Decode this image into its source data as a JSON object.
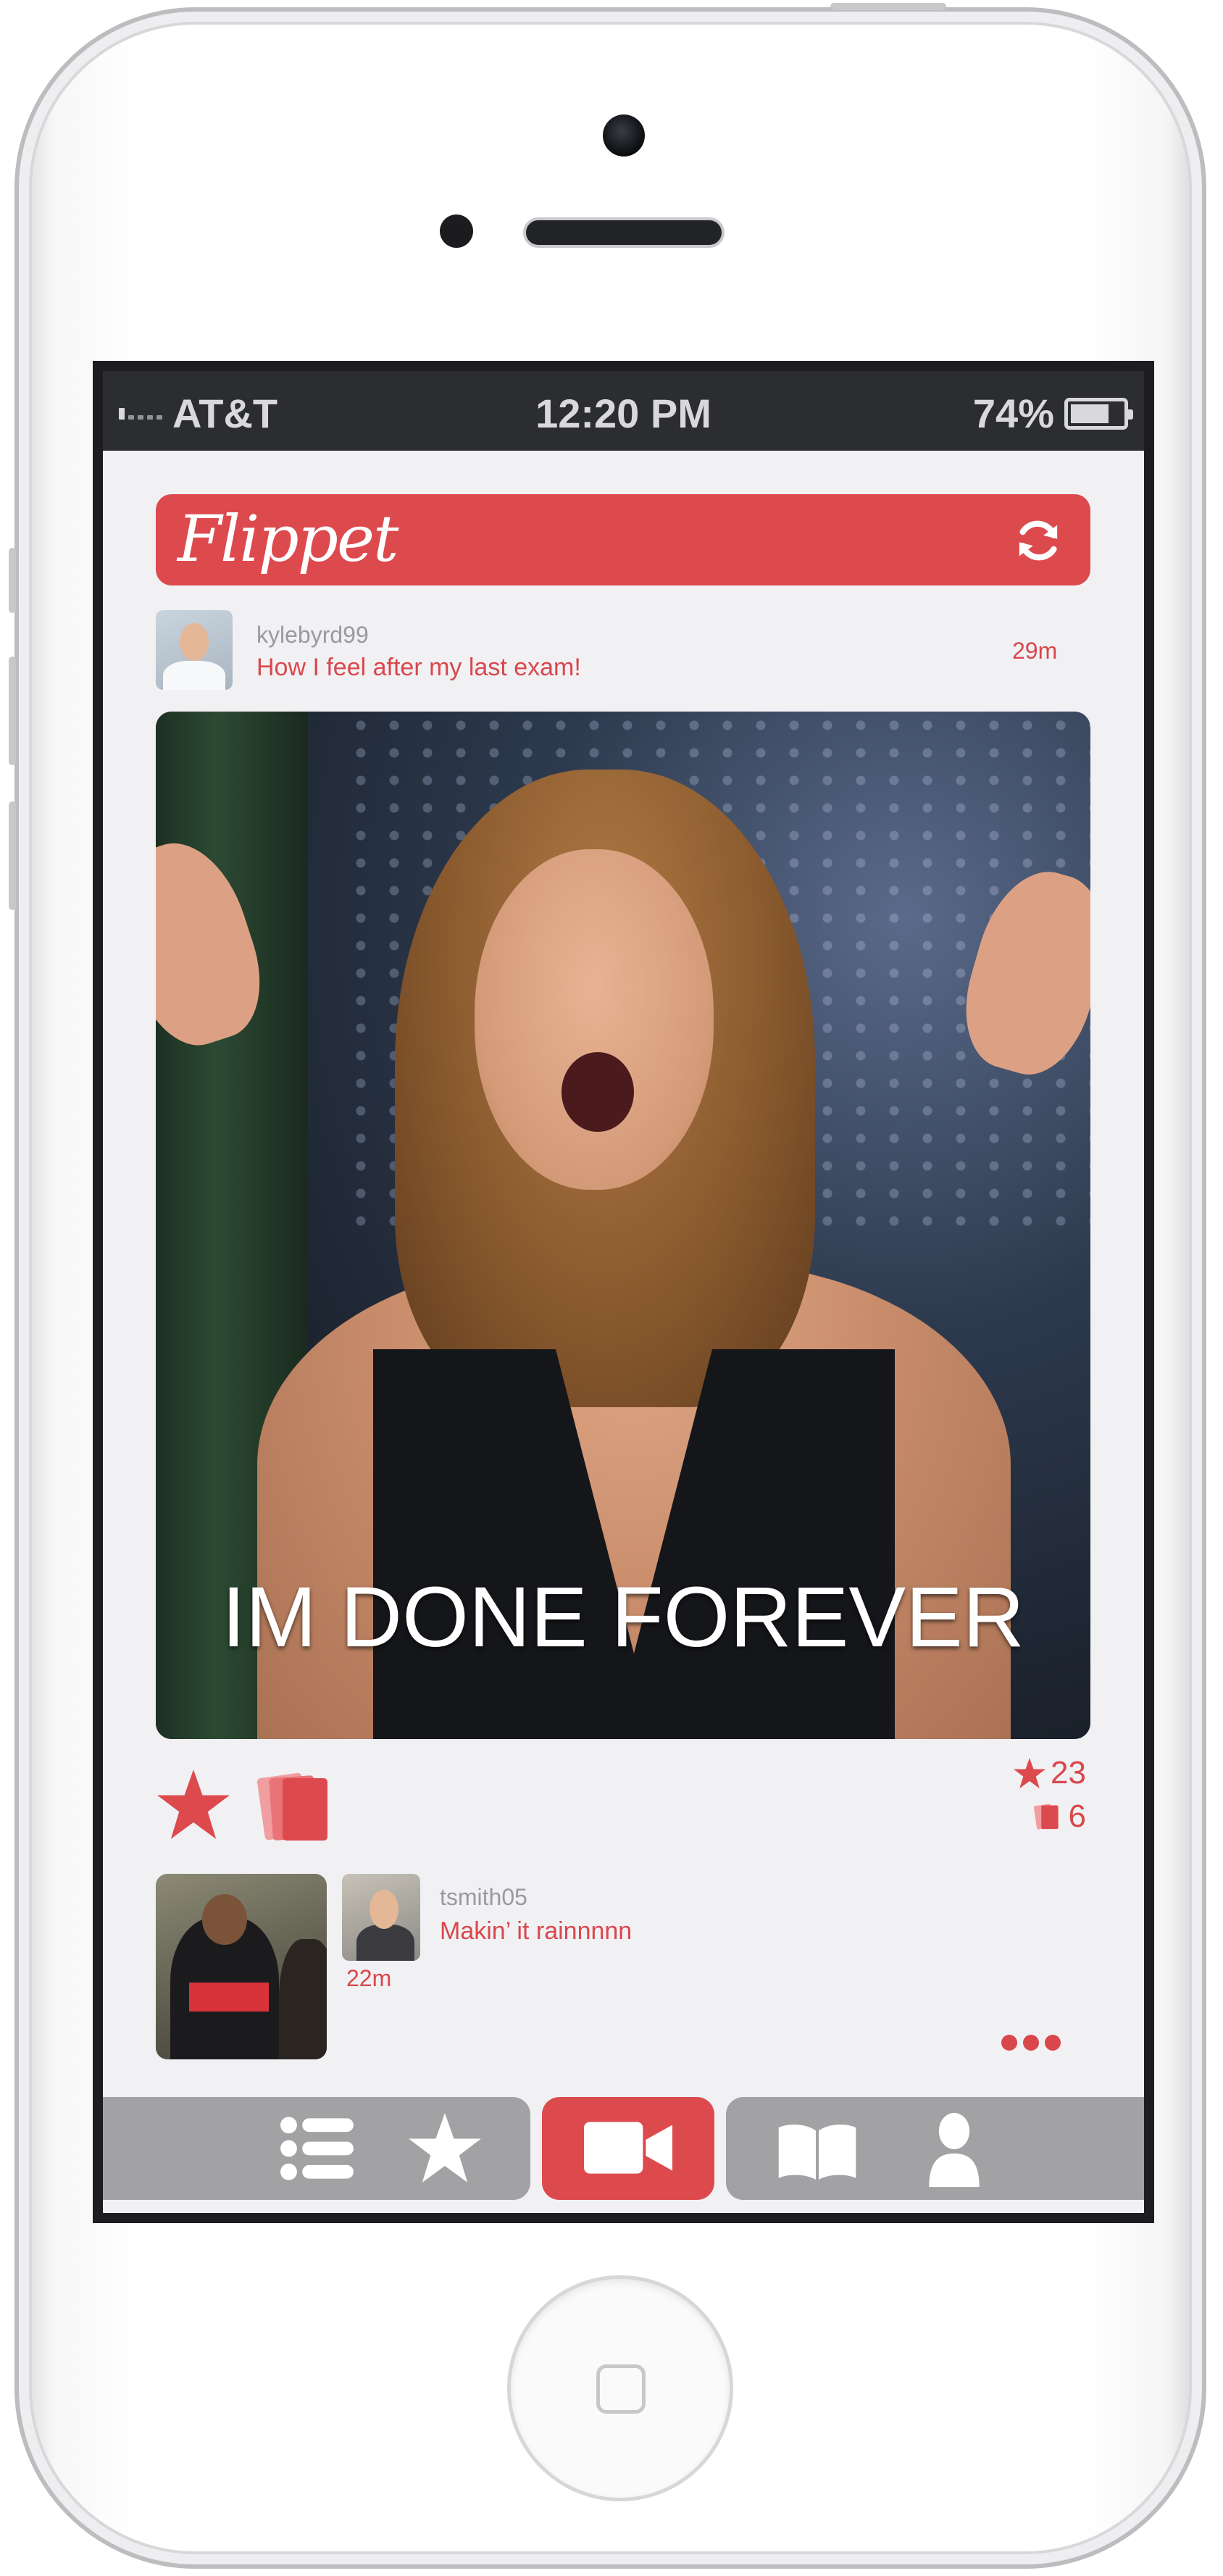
{
  "status_bar": {
    "carrier": "AT&T",
    "time": "12:20 PM",
    "battery_percent": "74%",
    "battery_level": 0.74
  },
  "app": {
    "title": "Flippet",
    "brand_color": "#dd4a4e"
  },
  "post": {
    "username": "kylebyrd99",
    "caption": "How I feel after my last exam!",
    "time_ago": "29m",
    "meme_text": "IM DONE FOREVER",
    "star_count": "23",
    "flip_count": "6"
  },
  "next_post": {
    "username": "tsmith05",
    "caption": "Makin’ it rainnnnn",
    "time_ago": "22m"
  },
  "icons": {
    "refresh": "refresh-icon",
    "star": "star-icon",
    "flip": "flip-cards-icon",
    "more": "more-dots-icon",
    "tabs": [
      "list-icon",
      "star-icon",
      "video-camera-icon",
      "book-icon",
      "profile-icon"
    ]
  },
  "tab_bar": {
    "active_tab": "video-camera"
  }
}
